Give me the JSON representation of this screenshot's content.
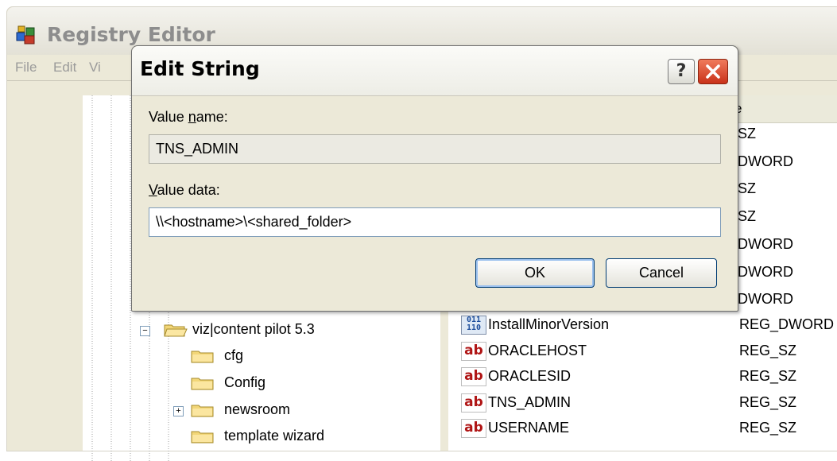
{
  "main_window": {
    "title": "Registry Editor",
    "menu": [
      "File",
      "Edit",
      "Vi"
    ],
    "list_header_type": "e"
  },
  "tree": [
    {
      "label": "viz|content pilot 5.3",
      "expander": "−",
      "open": true
    },
    {
      "label": "cfg"
    },
    {
      "label": "Config"
    },
    {
      "label": "newsroom",
      "expander": "+"
    },
    {
      "label": "template wizard"
    }
  ],
  "type_fragments": [
    "_SZ",
    "_DWORD",
    "_SZ",
    "_SZ",
    "_DWORD",
    "_DWORD",
    "_DWORD"
  ],
  "values": [
    {
      "name": "InstallMinorVersion",
      "type": "REG_DWORD",
      "icon": "binary-value-icon"
    },
    {
      "name": "ORACLEHOST",
      "type": "REG_SZ",
      "icon": "string-value-icon"
    },
    {
      "name": "ORACLESID",
      "type": "REG_SZ",
      "icon": "string-value-icon"
    },
    {
      "name": "TNS_ADMIN",
      "type": "REG_SZ",
      "icon": "string-value-icon"
    },
    {
      "name": "USERNAME",
      "type": "REG_SZ",
      "icon": "string-value-icon"
    }
  ],
  "dialog": {
    "title": "Edit String",
    "help_label": "?",
    "value_name_label_pre": "Value ",
    "value_name_label_accel": "n",
    "value_name_label_post": "ame:",
    "value_name": "TNS_ADMIN",
    "value_data_label_accel": "V",
    "value_data_label_post": "alue data:",
    "value_data": "\\\\<hostname>\\<shared_folder>",
    "ok_label": "OK",
    "cancel_label": "Cancel"
  }
}
